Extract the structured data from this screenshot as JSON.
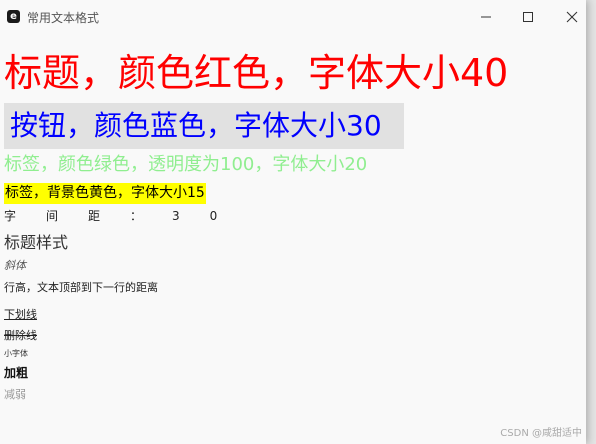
{
  "window": {
    "title": "常用文本格式",
    "app_icon": "e",
    "controls": {
      "minimize": "minimize-icon",
      "maximize": "maximize-icon",
      "close": "close-icon"
    }
  },
  "content": {
    "title_label": "标题，颜色红色，字体大小40",
    "button_label": "按钮，颜色蓝色，字体大小30",
    "green_label": "标签，颜色绿色，透明度为100，字体大小20",
    "yellow_label": "标签，背景色黄色，字体大小15",
    "spacing_label": "字间距：30",
    "heading_style": "标题样式",
    "italic": "斜体",
    "line_height": "行高，文本顶部到下一行的距离",
    "underline": "下划线",
    "strikethrough": "删除线",
    "small_font": "小字体",
    "bold": "加粗",
    "weak": "减弱"
  },
  "watermark": "CSDN @咸甜适中",
  "colors": {
    "title": "#ff0000",
    "button_text": "#0000ff",
    "button_bg": "#e1e1e1",
    "green_label": "#90ee90",
    "yellow_bg": "#ffff00",
    "weak": "#999999"
  }
}
